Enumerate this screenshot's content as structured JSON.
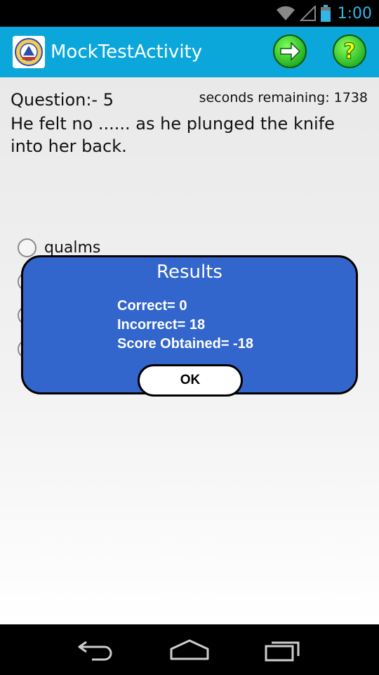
{
  "status_bar": {
    "time": "1:00",
    "icons": [
      "wifi-icon",
      "signal-icon",
      "battery-icon"
    ]
  },
  "action_bar": {
    "title": "MockTestActivity",
    "icons": [
      "app-logo",
      "arrow-right-icon",
      "help-icon"
    ]
  },
  "question": {
    "number_label": "Question:- 5",
    "timer": "seconds remaining: 1738",
    "text": "He felt no ...... as he plunged the knife into her back."
  },
  "options": [
    {
      "label": "qualms"
    },
    {
      "label": ""
    },
    {
      "label": ""
    },
    {
      "label": ""
    }
  ],
  "dialog": {
    "title": "Results",
    "correct": "Correct= 0",
    "incorrect": "Incorrect= 18",
    "score": "Score Obtained= -18",
    "ok_label": "OK"
  },
  "nav_bar": {
    "icons": [
      "back-icon",
      "home-icon",
      "recents-icon"
    ]
  },
  "colors": {
    "action_bar": "#0ba7db",
    "dialog": "#3366cc",
    "status_time": "#33b5e5",
    "green_button": "#33cc33"
  }
}
